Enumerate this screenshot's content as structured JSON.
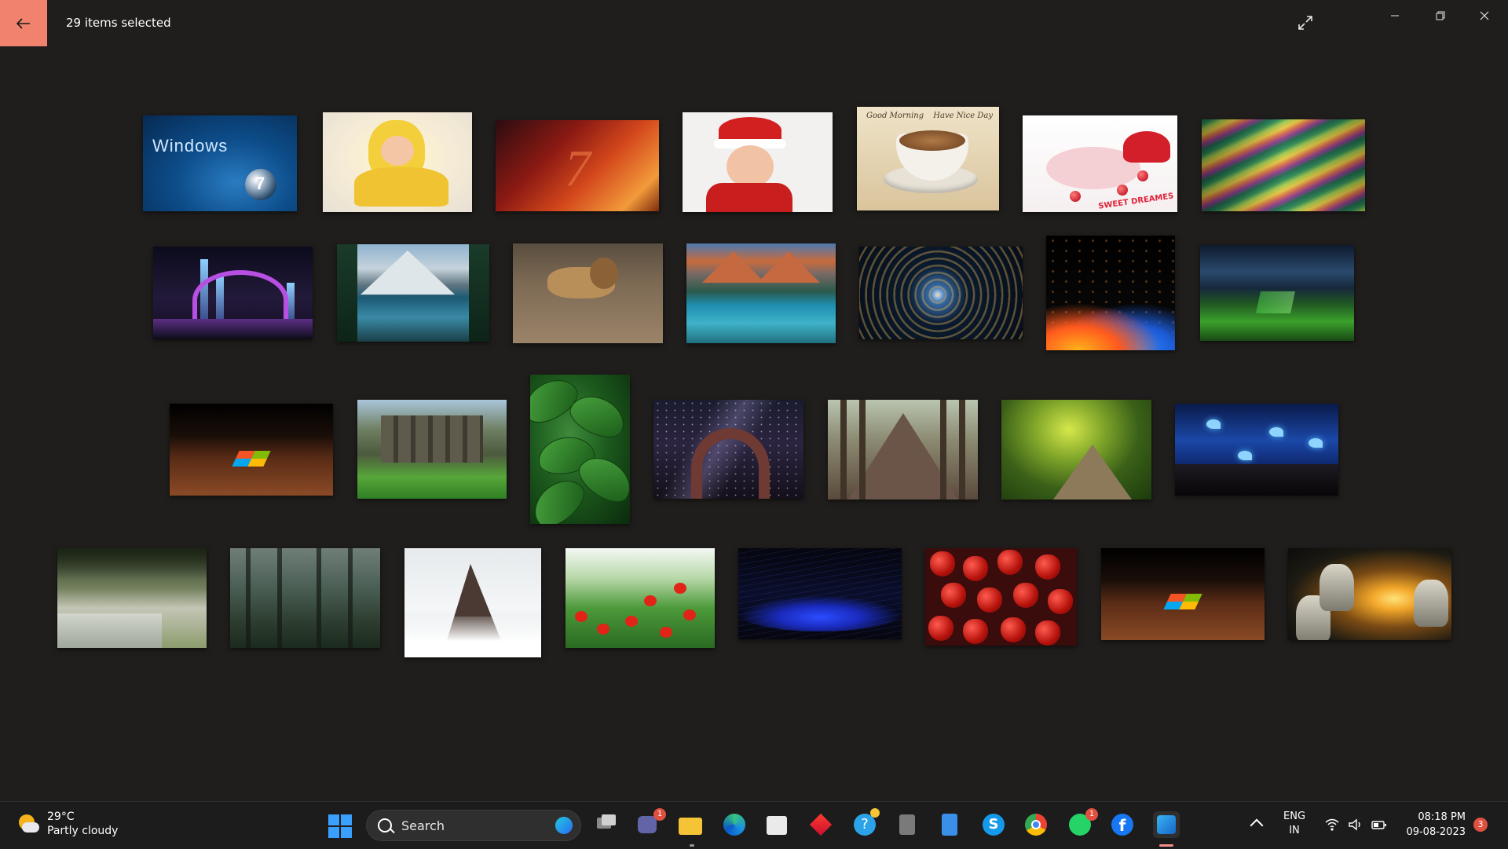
{
  "window": {
    "title": "29 items selected"
  },
  "gallery": {
    "w7_text": "Windows",
    "w7_orb": "7",
    "w7red_text": "7",
    "coffee_left": "Good Morning",
    "coffee_right": "Have Nice Day",
    "sweet_dreams": "SWEET DREAMES"
  },
  "taskbar": {
    "weather_temp": "29°C",
    "weather_condition": "Partly cloudy",
    "search_label": "Search",
    "teams_badge": "1",
    "whatsapp_badge": "1",
    "lang_top": "ENG",
    "lang_bottom": "IN",
    "time": "08:18 PM",
    "date": "09-08-2023",
    "notification_count": "3"
  },
  "colors": {
    "back_button": "#f0826e",
    "background": "#201e1c",
    "taskbar": "#1c1c1c",
    "badge": "#e05040"
  },
  "icons": [
    "back-arrow-icon",
    "expand-icon",
    "minimize-icon",
    "restore-icon",
    "close-icon",
    "start-icon",
    "search-icon",
    "bing-icon",
    "task-view-icon",
    "teams-icon",
    "file-explorer-icon",
    "edge-icon",
    "store-icon",
    "app-diamond-icon",
    "help-icon",
    "calculator-icon",
    "notepad-icon",
    "skype-icon",
    "chrome-icon",
    "whatsapp-icon",
    "facebook-icon",
    "photos-icon",
    "wifi-icon",
    "volume-icon",
    "battery-icon"
  ]
}
